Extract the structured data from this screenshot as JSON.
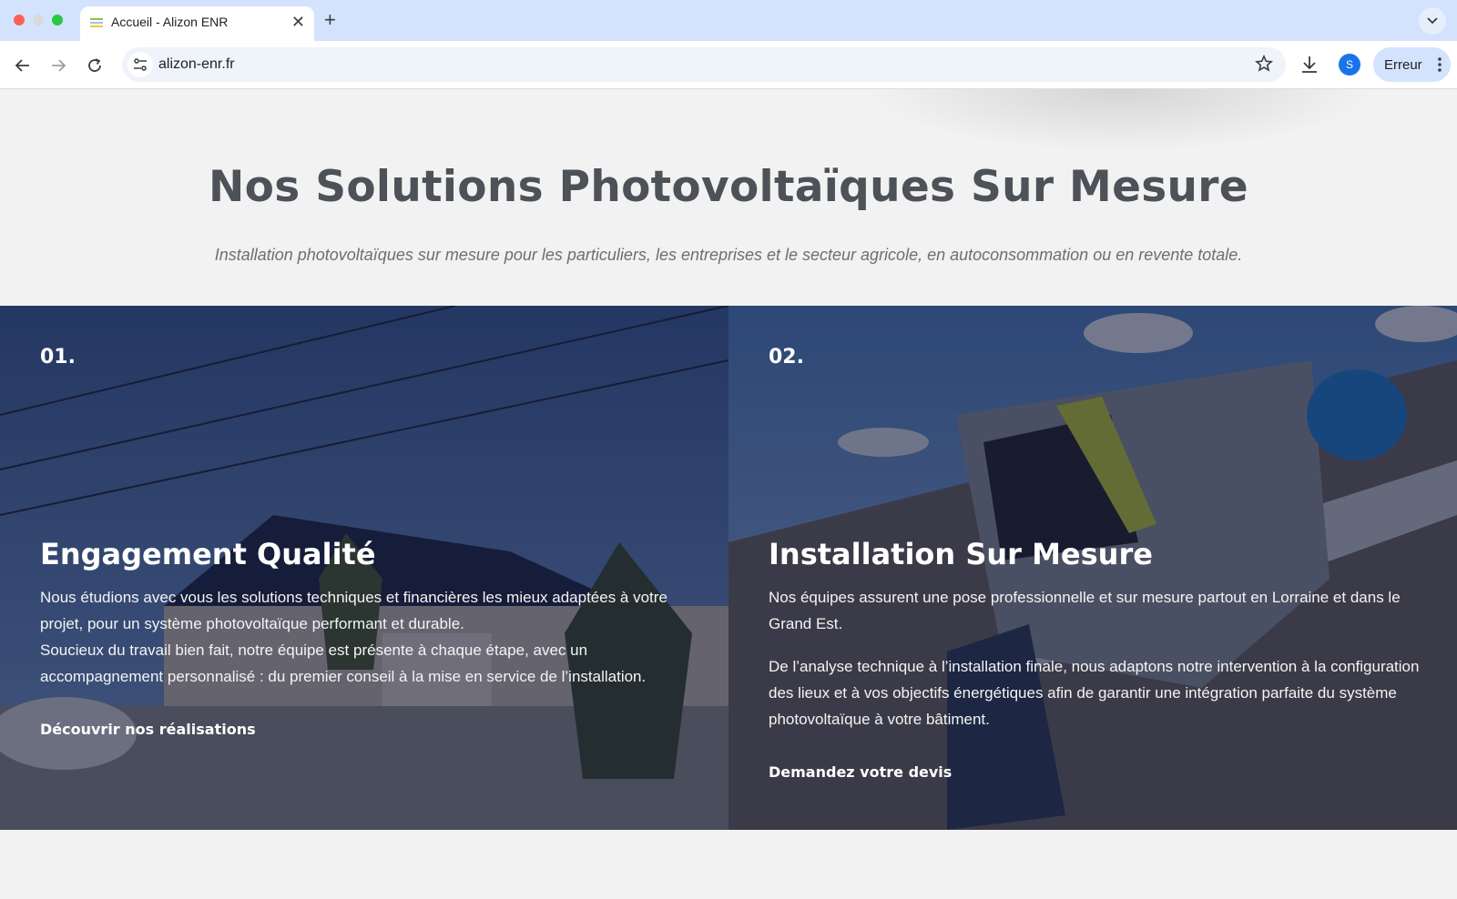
{
  "browser": {
    "tab_title": "Accueil - Alizon ENR",
    "url": "alizon-enr.fr",
    "profile_initial": "S",
    "error_label": "Erreur"
  },
  "hero": {
    "title": "Nos Solutions Photovoltaïques Sur Mesure",
    "subtitle": "Installation photovoltaïques sur mesure pour les particuliers, les entreprises et le secteur agricole, en autoconsommation ou en revente totale."
  },
  "panels": [
    {
      "number": "01.",
      "title": "Engagement Qualité",
      "paragraph1": "Nous étudions avec vous les solutions techniques et financières les mieux adaptées à votre projet, pour un système photovoltaïque performant et durable.",
      "paragraph2": "Soucieux du travail bien fait, notre équipe est présente à chaque étape, avec un accompagnement personnalisé : du premier conseil à la mise en service de l’installation.",
      "link": "Découvrir nos réalisations"
    },
    {
      "number": "02.",
      "title": "Installation Sur Mesure",
      "paragraph1": "Nos équipes assurent une pose professionnelle et sur mesure partout en Lorraine et dans le Grand Est.",
      "paragraph2": "De l’analyse technique à l’installation finale, nous adaptons notre intervention à la configuration des lieux et à vos objectifs énergétiques afin de garantir une intégration parfaite du système photovoltaïque à votre bâtiment.",
      "link": "Demandez votre devis"
    }
  ],
  "colors": {
    "tabbar": "#d3e3fd",
    "title_gray": "#4d5258",
    "overlay": "#121834"
  }
}
